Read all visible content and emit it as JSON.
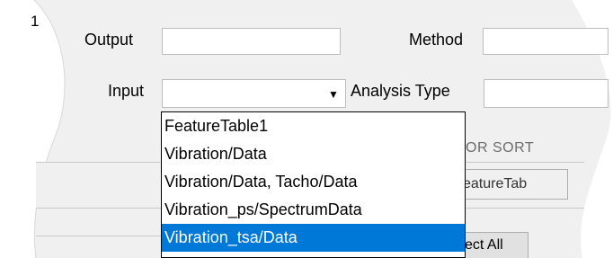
{
  "panel": {
    "tab_number": "1",
    "output_label": "Output",
    "output_value": "",
    "method_label": "Method",
    "method_value": "",
    "input_label": "Input",
    "input_value": "",
    "analysis_type_label": "Analysis Type",
    "analysis_type_value": "",
    "section_header_fragment": "OR SORT",
    "tab_fragment": "eatureTab",
    "button_fragment": "ect All"
  },
  "dropdown": {
    "items": [
      "FeatureTable1",
      "Vibration/Data",
      "Vibration/Data, Tacho/Data",
      "Vibration_ps/SpectrumData",
      "Vibration_tsa/Data"
    ],
    "selected_index": 4
  },
  "colors": {
    "selection": "#0078d7",
    "panel_background": "#f0f0f0"
  },
  "icons": {
    "combo_arrow": "chevron-down-icon"
  }
}
